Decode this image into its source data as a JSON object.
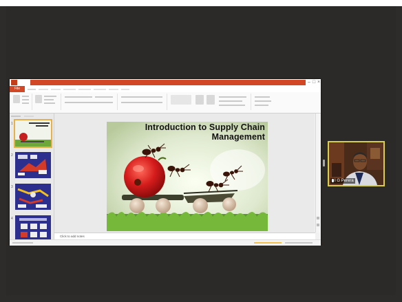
{
  "slide": {
    "title_line1": "Introduction to Supply Chain",
    "title_line2": "Management"
  },
  "ppt": {
    "file_tab": "File",
    "notes_placeholder": "Click to add notes",
    "slide_numbers": [
      "1",
      "2",
      "3",
      "4"
    ],
    "selected_slide": 1
  },
  "participant": {
    "name": "I G Perera"
  },
  "colors": {
    "background": "#2e2c2a",
    "powerpoint_accent": "#d24726",
    "active_speaker_border": "#d8d04a",
    "thumbnail_blue": "#2d2f8f"
  },
  "icons": [
    "powerpoint-app-icon",
    "microphone-icon"
  ]
}
